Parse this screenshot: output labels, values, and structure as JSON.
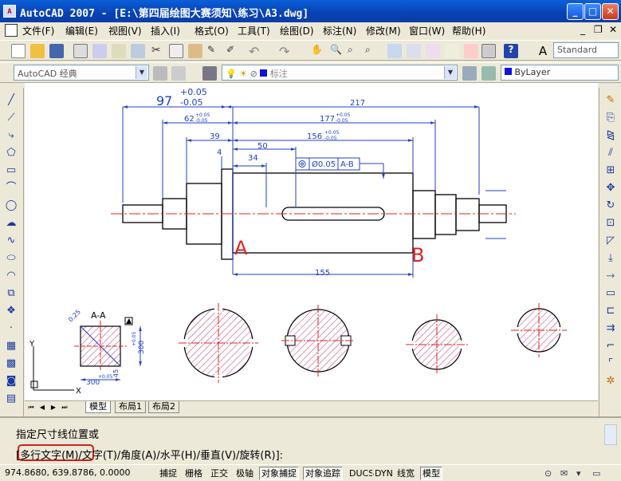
{
  "window": {
    "title": "AutoCAD 2007 - [E:\\第四届绘图大赛须知\\练习\\A3.dwg]",
    "app_icon": "A"
  },
  "menu": [
    "文件(F)",
    "编辑(E)",
    "视图(V)",
    "插入(I)",
    "格式(O)",
    "工具(T)",
    "绘图(D)",
    "标注(N)",
    "修改(M)",
    "窗口(W)",
    "帮助(H)"
  ],
  "toolbar": {
    "workspace": "AutoCAD 经典",
    "text_style": "Standard",
    "layer": "标注",
    "color": "ByLayer"
  },
  "dims": {
    "d97": "97",
    "d97_tol_upper": "+0.05",
    "d97_tol_lower": "-0.05",
    "d217": "217",
    "d62": "62",
    "d62_tol_upper": "+0.05",
    "d62_tol_lower": "-0.05",
    "d177": "177",
    "d177_tol_upper": "+0.05",
    "d177_tol_lower": "-0.05",
    "d39": "39",
    "d50": "50",
    "d156": "156",
    "d156_tol_upper": "+0.05",
    "d156_tol_lower": "-0.05",
    "d4": "4",
    "d34": "34",
    "d155": "155",
    "frame_tol": "Ø0.05",
    "frame_datum": "A-B",
    "label_a": "A",
    "label_b": "B"
  },
  "section": {
    "title": "A-A",
    "d300": "300",
    "d300_tol": "+0.05",
    "d300v": "300",
    "d300v_tol": "+0.05",
    "d0_25": "0.25",
    "d_angle": "45",
    "axis_x": "X",
    "axis_y": "Y"
  },
  "tabs": [
    "模型",
    "布局1",
    "布局2"
  ],
  "command": {
    "line1": "指定尺寸线位置或",
    "line2_highlight": "[多行文字(M)",
    "line2_rest": "/文字(T)/角度(A)/水平(H)/垂直(V)/旋转(R)]:"
  },
  "status": {
    "coords": "974.8680, 639.8786, 0.0000",
    "toggles": [
      "捕捉",
      "栅格",
      "正交",
      "极轴",
      "对象捕捉",
      "对象追踪",
      "DUCS",
      "DYN",
      "线宽",
      "模型"
    ]
  }
}
